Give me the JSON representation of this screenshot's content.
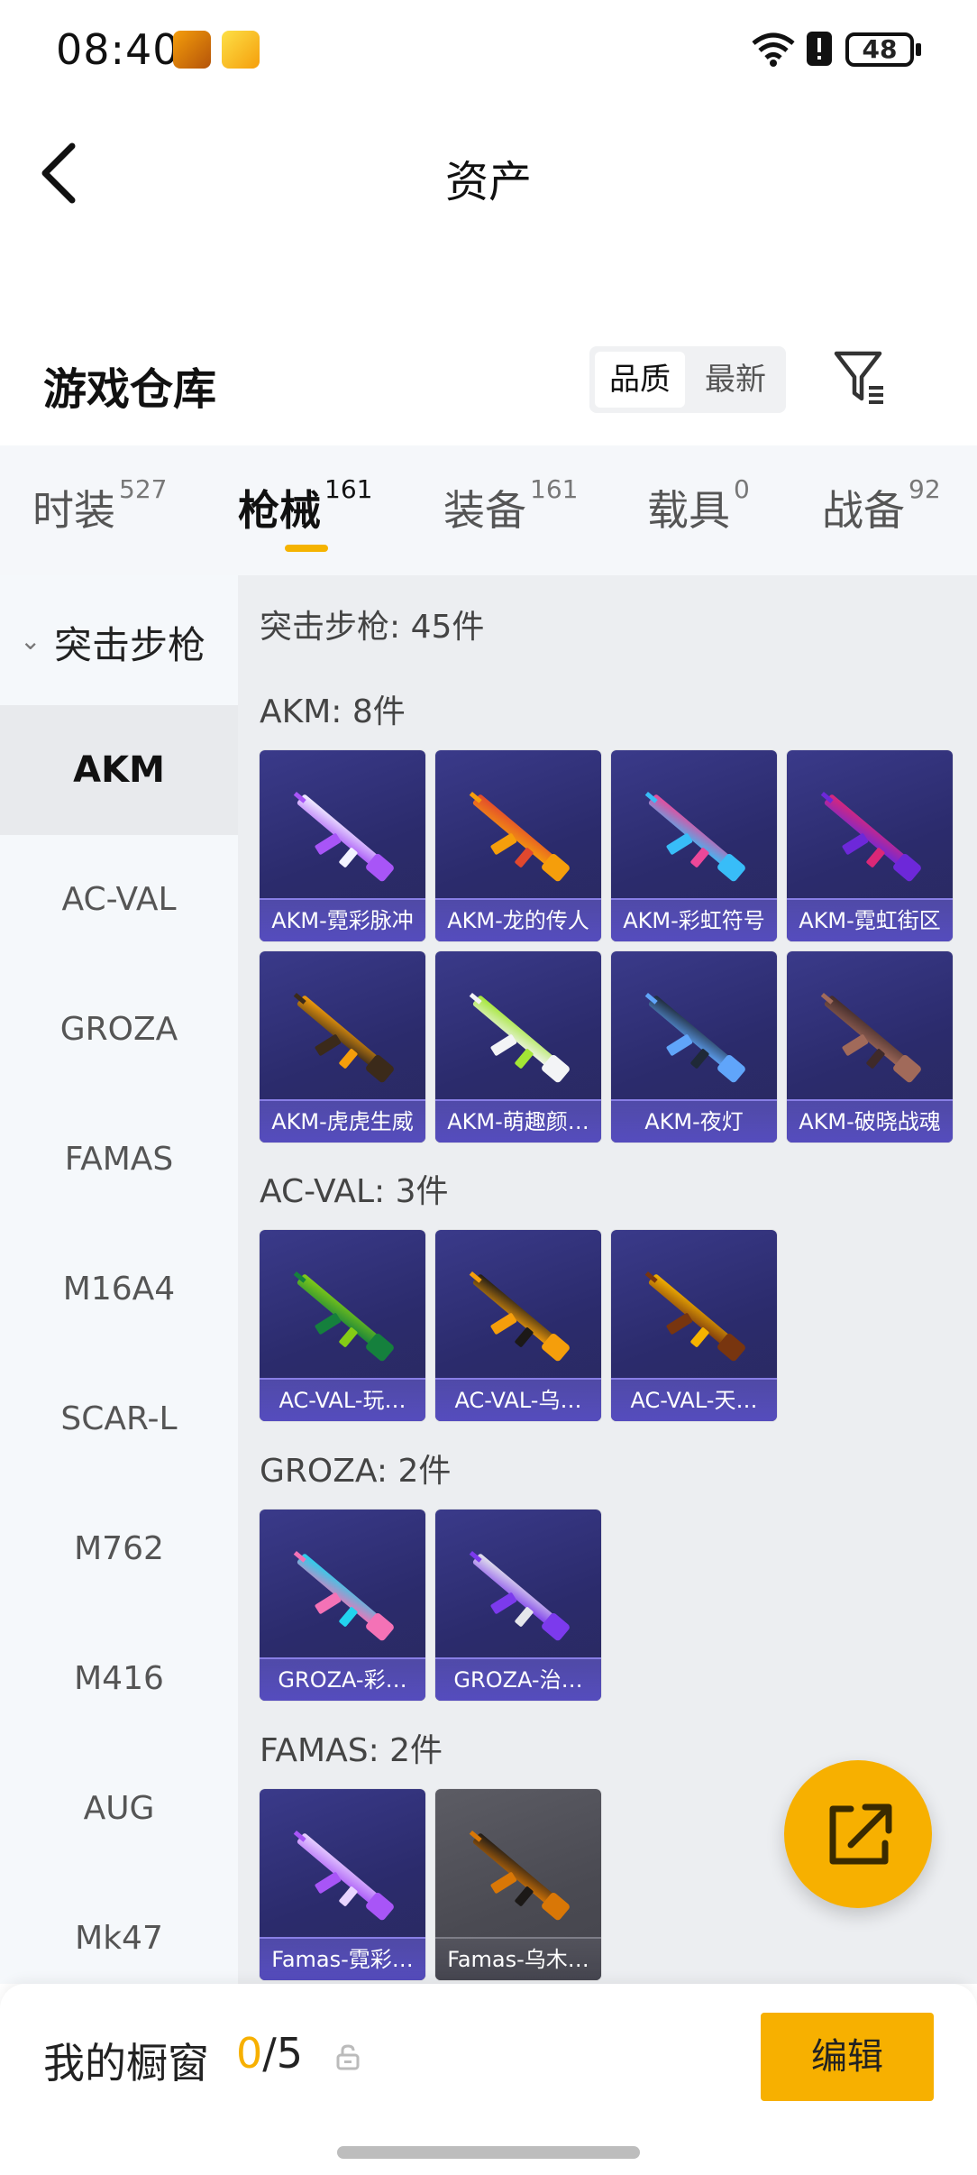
{
  "status_bar": {
    "time": "08:40",
    "battery": "48"
  },
  "header": {
    "title": "资产"
  },
  "warehouse": {
    "title": "游戏仓库",
    "sort_options": [
      "品质",
      "最新"
    ],
    "active_sort": "品质"
  },
  "tabs": [
    {
      "label": "时装",
      "count": "527"
    },
    {
      "label": "枪械",
      "count": "161"
    },
    {
      "label": "装备",
      "count": "161"
    },
    {
      "label": "载具",
      "count": "0"
    },
    {
      "label": "战备",
      "count": "92"
    }
  ],
  "active_tab": "枪械",
  "sidebar": {
    "category": "突击步枪",
    "items": [
      "AKM",
      "AC-VAL",
      "GROZA",
      "FAMAS",
      "M16A4",
      "SCAR-L",
      "M762",
      "M416",
      "AUG",
      "Mk47"
    ],
    "active": "AKM"
  },
  "main": {
    "summary": "突击步枪: 45件",
    "groups": [
      {
        "title": "AKM: 8件",
        "items": [
          {
            "name": "AKM-霓彩脉冲",
            "colors": [
              "#f3f3ff",
              "#a855f7"
            ]
          },
          {
            "name": "AKM-龙的传人",
            "colors": [
              "#e2482e",
              "#f59e0b"
            ]
          },
          {
            "name": "AKM-彩虹符号",
            "colors": [
              "#ec4899",
              "#38bdf8"
            ]
          },
          {
            "name": "AKM-霓虹街区",
            "colors": [
              "#db2777",
              "#6d28d9"
            ]
          },
          {
            "name": "AKM-虎虎生威",
            "colors": [
              "#f59e0b",
              "#3b2a1a"
            ]
          },
          {
            "name": "AKM-萌趣颜…",
            "colors": [
              "#a3e635",
              "#f3f4f6"
            ]
          },
          {
            "name": "AKM-夜灯",
            "colors": [
              "#1f2937",
              "#60a5fa"
            ]
          },
          {
            "name": "AKM-破晓战魂",
            "colors": [
              "#3f2a2a",
              "#a16a5a"
            ]
          }
        ]
      },
      {
        "title": "AC-VAL: 3件",
        "items": [
          {
            "name": "AC-VAL-玩…",
            "colors": [
              "#84cc16",
              "#15803d"
            ]
          },
          {
            "name": "AC-VAL-乌…",
            "colors": [
              "#1c1917",
              "#f59e0b"
            ]
          },
          {
            "name": "AC-VAL-天…",
            "colors": [
              "#f5b300",
              "#78350f"
            ]
          }
        ]
      },
      {
        "title": "GROZA: 2件",
        "items": [
          {
            "name": "GROZA-彩…",
            "colors": [
              "#22d3ee",
              "#f472b6"
            ]
          },
          {
            "name": "GROZA-治…",
            "colors": [
              "#e5e7eb",
              "#7c3aed"
            ]
          }
        ]
      },
      {
        "title": "FAMAS: 2件",
        "items": [
          {
            "name": "Famas-霓彩…",
            "colors": [
              "#e9d5ff",
              "#a855f7"
            ]
          },
          {
            "name": "Famas-乌木…",
            "colors": [
              "#1c1917",
              "#d97706"
            ],
            "grey": true
          }
        ]
      }
    ]
  },
  "showcase": {
    "title": "我的橱窗",
    "current": "0",
    "separator": "/",
    "max": "5",
    "edit_label": "编辑"
  },
  "colors": {
    "accent": "#f7b000"
  }
}
